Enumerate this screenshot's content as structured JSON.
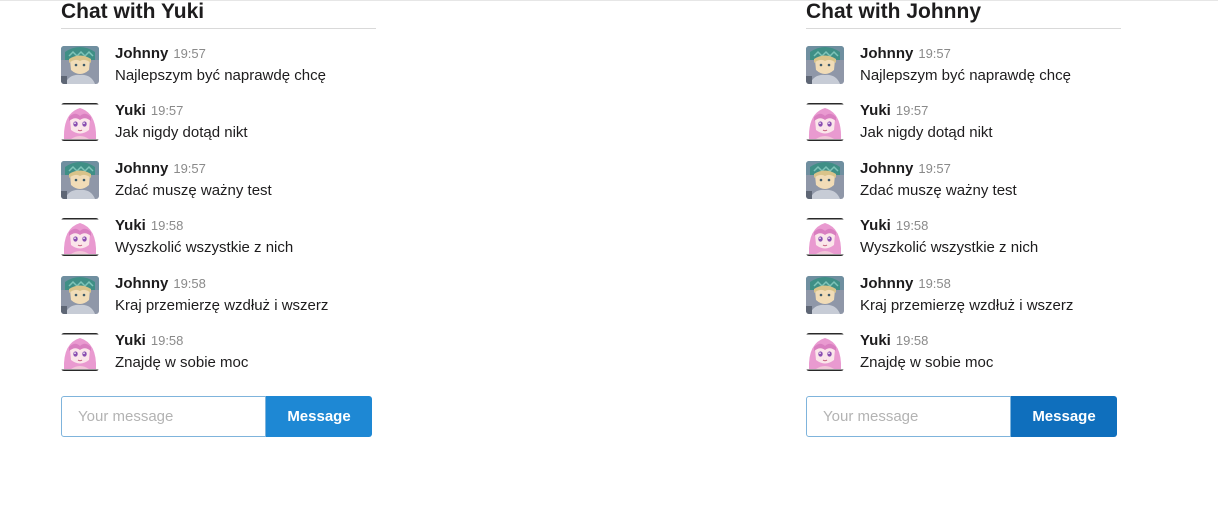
{
  "avatar_icons": {
    "Johnny": "johnny-avatar-icon",
    "Yuki": "yuki-avatar-icon"
  },
  "chats": [
    {
      "title": "Chat with Yuki",
      "messages": [
        {
          "author": "Johnny",
          "time": "19:57",
          "text": "Najlepszym być naprawdę chcę"
        },
        {
          "author": "Yuki",
          "time": "19:57",
          "text": "Jak nigdy dotąd nikt"
        },
        {
          "author": "Johnny",
          "time": "19:57",
          "text": "Zdać muszę ważny test"
        },
        {
          "author": "Yuki",
          "time": "19:58",
          "text": "Wyszkolić wszystkie z nich"
        },
        {
          "author": "Johnny",
          "time": "19:58",
          "text": "Kraj przemierzę wzdłuż i wszerz"
        },
        {
          "author": "Yuki",
          "time": "19:58",
          "text": "Znajdę w sobie moc"
        }
      ],
      "input": {
        "placeholder": "Your message",
        "value": ""
      },
      "send_label": "Message"
    },
    {
      "title": "Chat with Johnny",
      "messages": [
        {
          "author": "Johnny",
          "time": "19:57",
          "text": "Najlepszym być naprawdę chcę"
        },
        {
          "author": "Yuki",
          "time": "19:57",
          "text": "Jak nigdy dotąd nikt"
        },
        {
          "author": "Johnny",
          "time": "19:57",
          "text": "Zdać muszę ważny test"
        },
        {
          "author": "Yuki",
          "time": "19:58",
          "text": "Wyszkolić wszystkie z nich"
        },
        {
          "author": "Johnny",
          "time": "19:58",
          "text": "Kraj przemierzę wzdłuż i wszerz"
        },
        {
          "author": "Yuki",
          "time": "19:58",
          "text": "Znajdę w sobie moc"
        }
      ],
      "input": {
        "placeholder": "Your message",
        "value": ""
      },
      "send_label": "Message"
    }
  ]
}
